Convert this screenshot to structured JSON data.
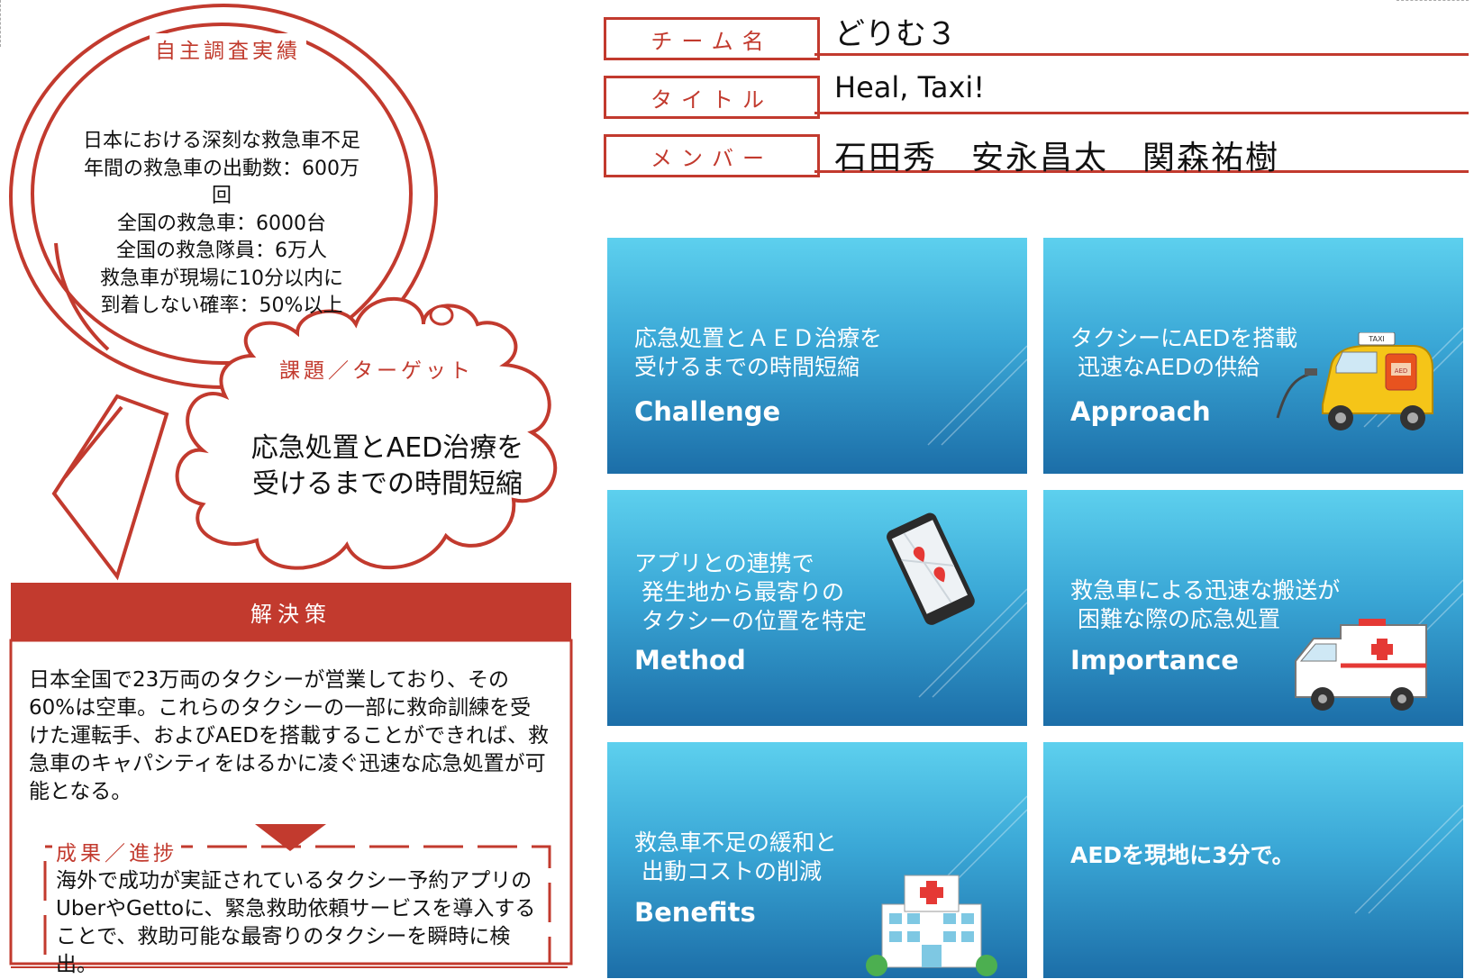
{
  "header": {
    "team_label": "チーム名",
    "team_value": "どりむ３",
    "title_label": "タイトル",
    "title_value": "Heal, Taxi!",
    "member_label": "メンバー",
    "member_value": "石田秀　安永昌太　関森祐樹"
  },
  "research": {
    "title": "自主調査実績",
    "lines": [
      "日本における深刻な救急車不足",
      "年間の救急車の出動数：600万",
      "回",
      "全国の救急車：6000台",
      "全国の救急隊員：6万人",
      "救急車が現場に10分以内に",
      "到着しない確率：50%以上"
    ]
  },
  "target": {
    "title": "課題／ターゲット",
    "line1": "応急処置とAED治療を",
    "line2": "受けるまでの時間短縮"
  },
  "solution": {
    "title": "解決策",
    "text": "日本全国で23万両のタクシーが営業しており、その60%は空車。これらのタクシーの一部に救命訓練を受けた運転手、およびAEDを搭載することができれば、救急車のキャパシティをはるかに凌ぐ迅速な応急処置が可能となる。"
  },
  "result": {
    "title": "成果／進捗",
    "text": "海外で成功が実証されているタクシー予約アプリのUberやGettoに、緊急救助依頼サービスを導入することで、救助可能な最寄りのタクシーを瞬時に検出。"
  },
  "tiles": [
    {
      "jp": "応急処置とＡＥＤ治療を\n受けるまでの時間短縮",
      "en": "Challenge",
      "icon": "none"
    },
    {
      "jp": "タクシーにAEDを搭載\n 迅速なAEDの供給",
      "en": "Approach",
      "icon": "taxi-icon",
      "taxi_sign": "TAXI",
      "aed_label": "AED"
    },
    {
      "jp": "アプリとの連携で\n 発生地から最寄りの\n タクシーの位置を特定",
      "en": "Method",
      "icon": "smartphone-map-icon"
    },
    {
      "jp": "救急車による迅速な搬送が\n 困難な際の応急処置",
      "en": "Importance",
      "icon": "ambulance-icon"
    },
    {
      "jp": "救急車不足の緩和と\n 出動コストの削減",
      "en": "Benefits",
      "icon": "hospital-icon"
    },
    {
      "jp": "",
      "en": "AEDを現地に3分で。",
      "icon": "none"
    }
  ],
  "colors": {
    "accent_red": "#c23a2e",
    "tile_top": "#5dd0ee",
    "tile_bottom": "#1c6ea8"
  }
}
